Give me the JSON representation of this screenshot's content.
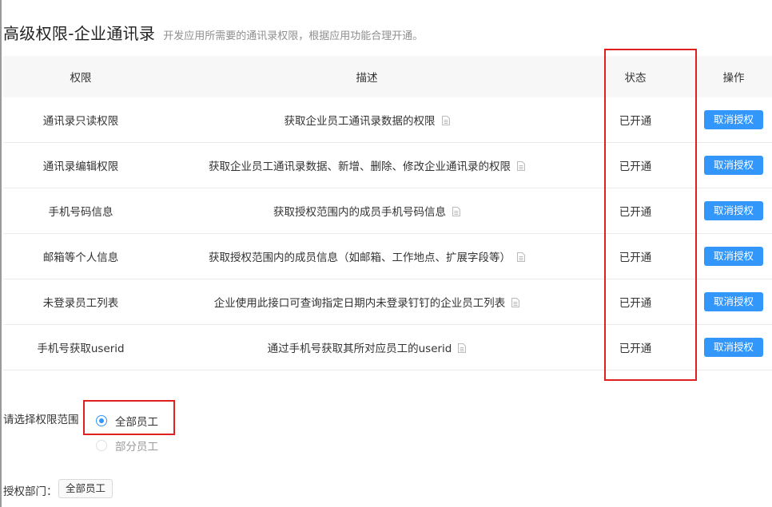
{
  "header": {
    "title": "高级权限-企业通讯录",
    "subtitle": "开发应用所需要的通讯录权限，根据应用功能合理开通。"
  },
  "table": {
    "columns": [
      "权限",
      "描述",
      "状态",
      "操作"
    ],
    "rows": [
      {
        "permission": "通讯录只读权限",
        "description": "获取企业员工通讯录数据的权限",
        "status": "已开通",
        "action": "取消授权"
      },
      {
        "permission": "通讯录编辑权限",
        "description": "获取企业员工通讯录数据、新增、删除、修改企业通讯录的权限",
        "status": "已开通",
        "action": "取消授权"
      },
      {
        "permission": "手机号码信息",
        "description": "获取授权范围内的成员手机号码信息",
        "status": "已开通",
        "action": "取消授权"
      },
      {
        "permission": "邮箱等个人信息",
        "description": "获取授权范围内的成员信息（如邮箱、工作地点、扩展字段等）",
        "status": "已开通",
        "action": "取消授权"
      },
      {
        "permission": "未登录员工列表",
        "description": "企业使用此接口可查询指定日期内未登录钉钉的企业员工列表",
        "status": "已开通",
        "action": "取消授权"
      },
      {
        "permission": "手机号获取userid",
        "description": "通过手机号获取其所对应员工的userid",
        "status": "已开通",
        "action": "取消授权"
      }
    ]
  },
  "scope": {
    "label": "请选择权限范围",
    "options": [
      {
        "label": "全部员工",
        "selected": true
      },
      {
        "label": "部分员工",
        "selected": false
      }
    ]
  },
  "department": {
    "label": "授权部门：",
    "tag": "全部员工"
  },
  "colors": {
    "accent": "#3296fa",
    "highlight_box": "#e02020"
  }
}
